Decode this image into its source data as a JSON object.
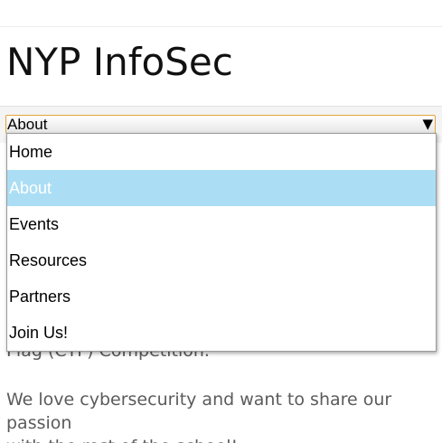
{
  "site": {
    "title": "NYP InfoSec"
  },
  "nav": {
    "selected_value": "About",
    "arrow_icon": "triangle-down-icon",
    "options": [
      {
        "label": "Home",
        "selected": false
      },
      {
        "label": "About",
        "selected": true
      },
      {
        "label": "Events",
        "selected": false
      },
      {
        "label": "Resources",
        "selected": false
      },
      {
        "label": "Partners",
        "selected": false
      },
      {
        "label": "Join Us!",
        "selected": false
      }
    ]
  },
  "content": {
    "paragraph_1_visible": "Flag (CTF) Competition.",
    "paragraph_2_line_1": "We love cybersecurity and want to share our passion",
    "paragraph_2_line_2": "with the rest of the school!"
  },
  "colors": {
    "focus_border": "#e3a33a",
    "selected_option_bg": "#abdef5",
    "body_text": "#5b5b5b"
  }
}
